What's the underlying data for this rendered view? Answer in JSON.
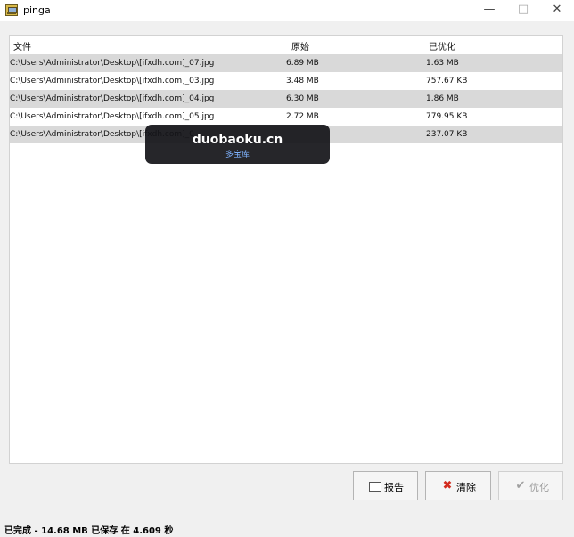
{
  "window": {
    "title": "pinga",
    "minimize_glyph": "—",
    "maximize_glyph": "□",
    "close_glyph": "✕"
  },
  "list": {
    "columns": [
      "文件",
      "原始",
      "已优化"
    ],
    "rows": [
      {
        "file": "C:\\Users\\Administrator\\Desktop\\[ifxdh.com]_07.jpg",
        "original": "6.89 MB",
        "optimized": "1.63 MB"
      },
      {
        "file": "C:\\Users\\Administrator\\Desktop\\[ifxdh.com]_03.jpg",
        "original": "3.48 MB",
        "optimized": "757.67 KB"
      },
      {
        "file": "C:\\Users\\Administrator\\Desktop\\[ifxdh.com]_04.jpg",
        "original": "6.30 MB",
        "optimized": "1.86 MB"
      },
      {
        "file": "C:\\Users\\Administrator\\Desktop\\[ifxdh.com]_05.jpg",
        "original": "2.72 MB",
        "optimized": "779.95 KB"
      },
      {
        "file": "C:\\Users\\Administrator\\Desktop\\[ifxdh.com]_0",
        "original": "",
        "optimized": "237.07 KB"
      }
    ]
  },
  "watermark": {
    "main": "duobaoku.cn",
    "sub": "多宝库"
  },
  "buttons": {
    "report": "报告",
    "clear": "清除",
    "optimize": "优化"
  },
  "icons": {
    "report": "report-icon",
    "clear": "x-icon",
    "optimize": "check-icon"
  },
  "status": {
    "text": "已完成 - 14.68 MB 已保存 在 4.609 秒"
  }
}
